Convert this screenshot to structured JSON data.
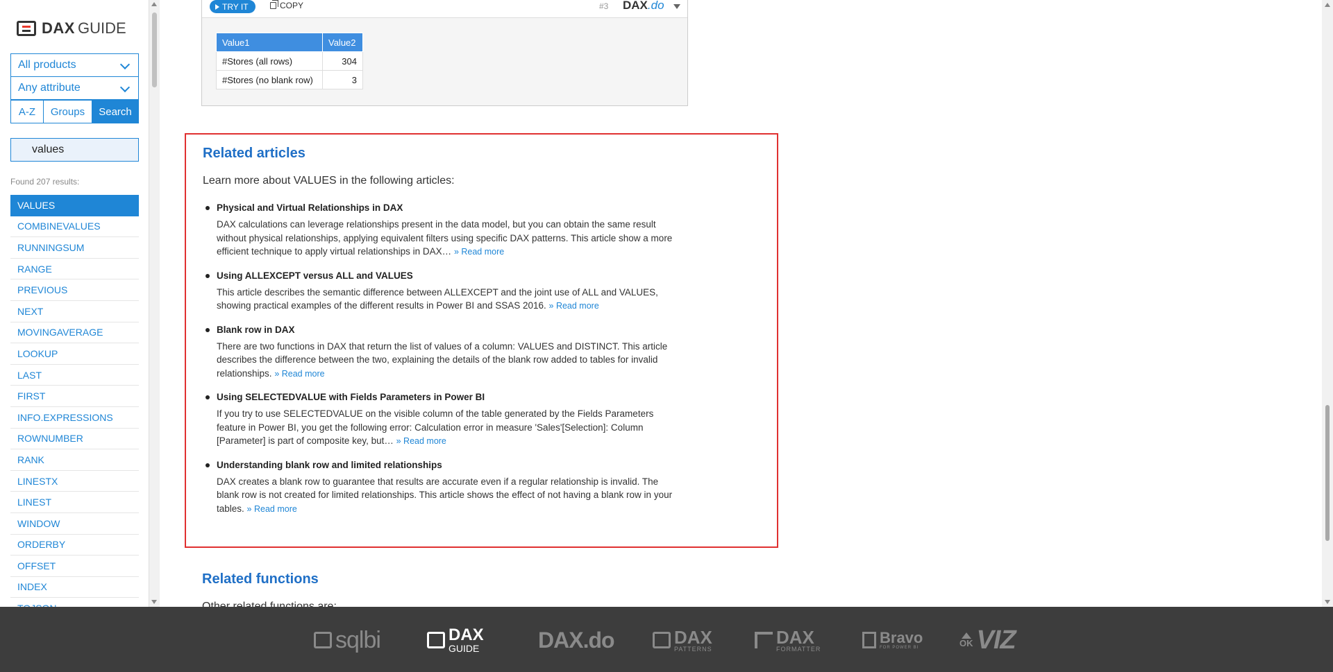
{
  "sidebar": {
    "logo": {
      "bold": "DAX",
      "light": "GUIDE"
    },
    "products_dropdown": "All products",
    "attribute_dropdown": "Any attribute",
    "tabs": [
      "A-Z",
      "Groups",
      "Search"
    ],
    "active_tab": "Search",
    "search_value": "values",
    "found_text": "Found 207 results:",
    "functions": [
      "VALUES",
      "COMBINEVALUES",
      "RUNNINGSUM",
      "RANGE",
      "PREVIOUS",
      "NEXT",
      "MOVINGAVERAGE",
      "LOOKUP",
      "LAST",
      "FIRST",
      "INFO.EXPRESSIONS",
      "ROWNUMBER",
      "RANK",
      "LINESTX",
      "LINEST",
      "WINDOW",
      "ORDERBY",
      "OFFSET",
      "INDEX",
      "TOJSON"
    ],
    "selected_function": "VALUES"
  },
  "code_toolbar": {
    "try_it": "TRY IT",
    "copy": "COPY",
    "query_number": "#3",
    "brand_bold": "DAX",
    "brand_italic": ".do"
  },
  "result_table": {
    "headers": [
      "Value1",
      "Value2"
    ],
    "rows": [
      [
        "#Stores (all rows)",
        "304"
      ],
      [
        "#Stores (no blank row)",
        "3"
      ]
    ]
  },
  "related_articles": {
    "title": "Related articles",
    "intro": "Learn more about VALUES in the following articles:",
    "read_more": "» Read more",
    "items": [
      {
        "title": "Physical and Virtual Relationships in DAX",
        "desc": "DAX calculations can leverage relationships present in the data model, but you can obtain the same result without physical relationships, applying equivalent filters using specific DAX patterns. This article show a more efficient technique to apply virtual relationships in DAX…"
      },
      {
        "title": "Using ALLEXCEPT versus ALL and VALUES",
        "desc": "This article describes the semantic difference between ALLEXCEPT and the joint use of ALL and VALUES, showing practical examples of the different results in Power BI and SSAS 2016."
      },
      {
        "title": "Blank row in DAX",
        "desc": "There are two functions in DAX that return the list of values of a column: VALUES and DISTINCT. This article describes the difference between the two, explaining the details of the blank row added to tables for invalid relationships."
      },
      {
        "title": "Using SELECTEDVALUE with Fields Parameters in Power BI",
        "desc": "If you try to use SELECTEDVALUE on the visible column of the table generated by the Fields Parameters feature in Power BI, you get the following error: Calculation error in measure 'Sales'[Selection]: Column [Parameter] is part of composite key, but…"
      },
      {
        "title": "Understanding blank row and limited relationships",
        "desc": "DAX creates a blank row to guarantee that results are accurate even if a regular relationship is invalid. The blank row is not created for limited relationships. This article shows the effect of not having a blank row in your tables."
      }
    ]
  },
  "related_functions": {
    "title": "Related functions",
    "intro": "Other related functions are:"
  },
  "footer": {
    "logos": [
      {
        "name": "sqlbi",
        "text": "sqlbi",
        "sub": ""
      },
      {
        "name": "dax-guide",
        "text": "DAX",
        "sub": "GUIDE"
      },
      {
        "name": "dax-do",
        "text": "DAX.do",
        "sub": ""
      },
      {
        "name": "dax-patterns",
        "text": "DAX",
        "sub": "PATTERNS"
      },
      {
        "name": "dax-formatter",
        "text": "DAX",
        "sub": "FORMATTER"
      },
      {
        "name": "bravo",
        "text": "Bravo",
        "sub": "FOR POWER BI"
      },
      {
        "name": "okviz",
        "text": "VIZ",
        "sub": "OK"
      }
    ]
  },
  "colors": {
    "accent": "#1f86d6",
    "highlight_border": "#e03030",
    "footer_bg": "#3d3d3d"
  }
}
